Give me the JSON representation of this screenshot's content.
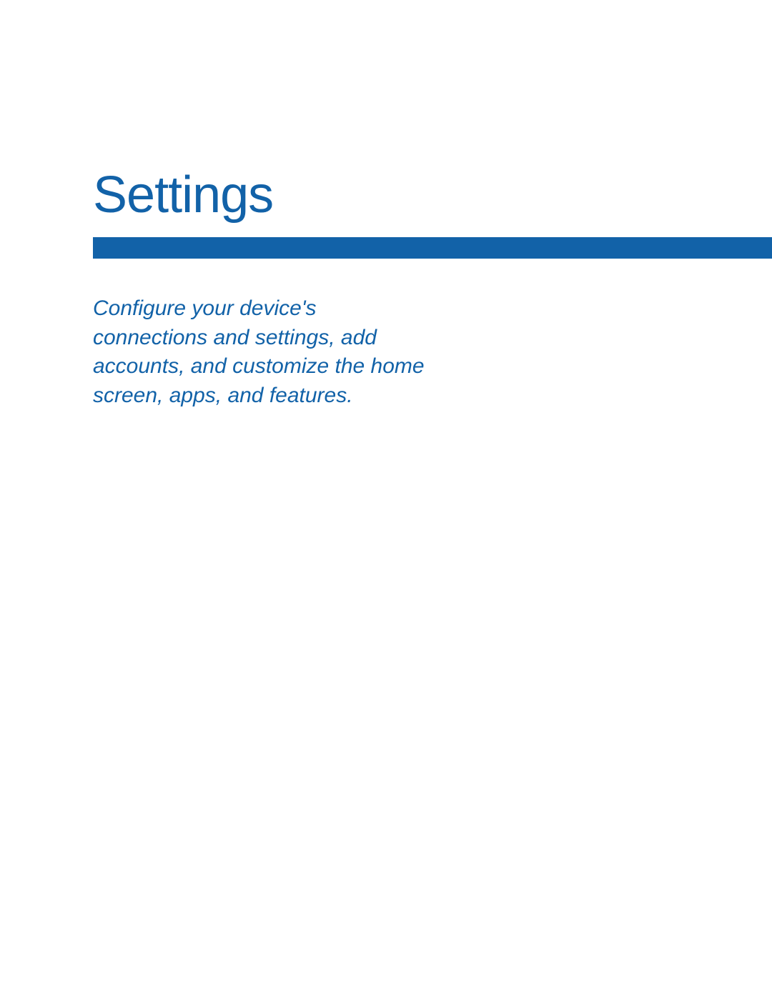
{
  "title": "Settings",
  "description": "Configure your device's connections and settings, add accounts, and customize the home screen, apps, and features."
}
